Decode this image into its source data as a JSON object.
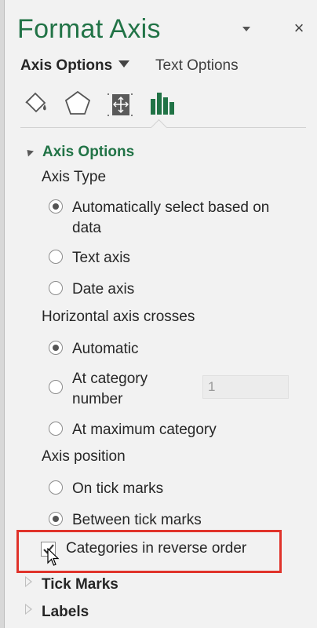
{
  "pane": {
    "title": "Format Axis",
    "close_glyph": "×",
    "menu_icon": "chevron-down-icon"
  },
  "tabs": {
    "axis_options": "Axis Options",
    "text_options": "Text Options"
  },
  "icons": [
    "paint-bucket-icon",
    "pentagon-effects-icon",
    "size-properties-icon",
    "bar-chart-icon"
  ],
  "colors": {
    "title_green": "#217346",
    "highlight_red": "#e0332b"
  },
  "axis_options": {
    "header": "Axis Options",
    "axis_type": {
      "label": "Axis Type",
      "options": [
        {
          "line1": "Automatically select based on",
          "line2": "data",
          "selected": true
        },
        {
          "text": "Text axis",
          "selected": false
        },
        {
          "text": "Date axis",
          "selected": false
        }
      ]
    },
    "h_axis_crosses": {
      "label": "Horizontal axis crosses",
      "options": [
        {
          "text": "Automatic",
          "selected": true
        },
        {
          "line1": "At category",
          "line2": "number",
          "selected": false,
          "input_value": "1"
        },
        {
          "text": "At maximum category",
          "selected": false
        }
      ]
    },
    "axis_position": {
      "label": "Axis position",
      "options": [
        {
          "text": "On tick marks",
          "selected": false
        },
        {
          "text": "Between tick marks",
          "selected": true
        }
      ]
    },
    "reverse_order": {
      "text": "Categories in reverse order",
      "checked": true
    }
  },
  "collapsed_sections": [
    "Tick Marks",
    "Labels"
  ]
}
